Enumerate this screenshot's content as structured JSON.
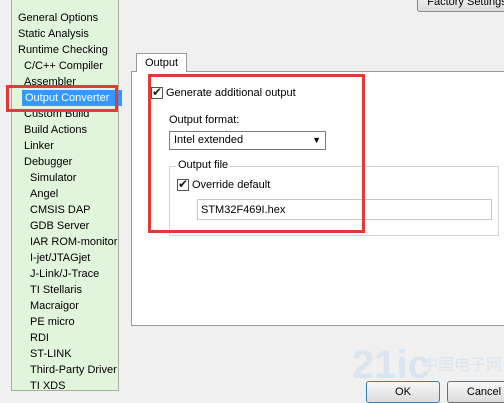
{
  "categories": [
    {
      "label": "General Options",
      "level": 0
    },
    {
      "label": "Static Analysis",
      "level": 0
    },
    {
      "label": "Runtime Checking",
      "level": 0
    },
    {
      "label": "C/C++ Compiler",
      "level": 1
    },
    {
      "label": "Assembler",
      "level": 1
    },
    {
      "label": "Output Converter",
      "level": 1,
      "selected": true
    },
    {
      "label": "Custom Build",
      "level": 1
    },
    {
      "label": "Build Actions",
      "level": 1
    },
    {
      "label": "Linker",
      "level": 1
    },
    {
      "label": "Debugger",
      "level": 1
    },
    {
      "label": "Simulator",
      "level": 2
    },
    {
      "label": "Angel",
      "level": 2
    },
    {
      "label": "CMSIS DAP",
      "level": 2
    },
    {
      "label": "GDB Server",
      "level": 2
    },
    {
      "label": "IAR ROM-monitor",
      "level": 2
    },
    {
      "label": "I-jet/JTAGjet",
      "level": 2
    },
    {
      "label": "J-Link/J-Trace",
      "level": 2
    },
    {
      "label": "TI Stellaris",
      "level": 2
    },
    {
      "label": "Macraigor",
      "level": 2
    },
    {
      "label": "PE micro",
      "level": 2
    },
    {
      "label": "RDI",
      "level": 2
    },
    {
      "label": "ST-LINK",
      "level": 2
    },
    {
      "label": "Third-Party Driver",
      "level": 2
    },
    {
      "label": "TI XDS",
      "level": 2
    }
  ],
  "toolbar": {
    "factory_settings_label": "Factory Settings"
  },
  "tab": {
    "label": "Output"
  },
  "output": {
    "generate_label": "Generate additional output",
    "generate_checked": true,
    "format_label": "Output format:",
    "format_value": "Intel extended",
    "file_group_label": "Output file",
    "override_label": "Override default",
    "override_checked": true,
    "file_name": "STM32F469I.hex"
  },
  "buttons": {
    "ok_label": "OK",
    "cancel_label": "Cancel"
  },
  "watermark": {
    "text": "21ic",
    "sub": "中国电子网"
  },
  "colors": {
    "sidebar_bg": "#e1f5dc",
    "selection": "#3399ff",
    "highlight_box": "#e53935"
  }
}
